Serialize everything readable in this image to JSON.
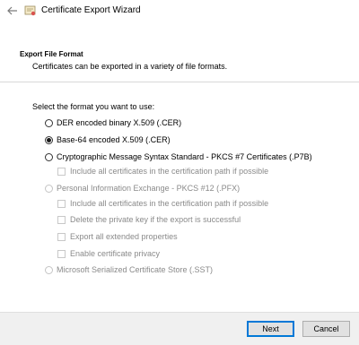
{
  "window": {
    "title": "Certificate Export Wizard",
    "back_icon": "back-arrow-icon",
    "app_icon": "certificate-icon"
  },
  "header": {
    "title": "Export File Format",
    "description": "Certificates can be exported in a variety of file formats."
  },
  "body": {
    "prompt": "Select the format you want to use:",
    "options": [
      {
        "label": "DER encoded binary X.509 (.CER)",
        "selected": false,
        "enabled": true
      },
      {
        "label": "Base-64 encoded X.509 (.CER)",
        "selected": true,
        "enabled": true
      },
      {
        "label": "Cryptographic Message Syntax Standard - PKCS #7 Certificates (.P7B)",
        "selected": false,
        "enabled": true
      },
      {
        "label": "Personal Information Exchange - PKCS #12 (.PFX)",
        "selected": false,
        "enabled": false
      },
      {
        "label": "Microsoft Serialized Certificate Store (.SST)",
        "selected": false,
        "enabled": false
      }
    ],
    "p7b_checks": [
      {
        "label": "Include all certificates in the certification path if possible",
        "checked": false,
        "enabled": false
      }
    ],
    "pfx_checks": [
      {
        "label": "Include all certificates in the certification path if possible",
        "checked": false,
        "enabled": false
      },
      {
        "label": "Delete the private key if the export is successful",
        "checked": false,
        "enabled": false
      },
      {
        "label": "Export all extended properties",
        "checked": false,
        "enabled": false
      },
      {
        "label": "Enable certificate privacy",
        "checked": false,
        "enabled": false
      }
    ]
  },
  "footer": {
    "next_label": "Next",
    "cancel_label": "Cancel"
  },
  "colors": {
    "accent": "#0078d7",
    "footer_bg": "#f0f0f0",
    "disabled_text": "#8a8a8a"
  }
}
